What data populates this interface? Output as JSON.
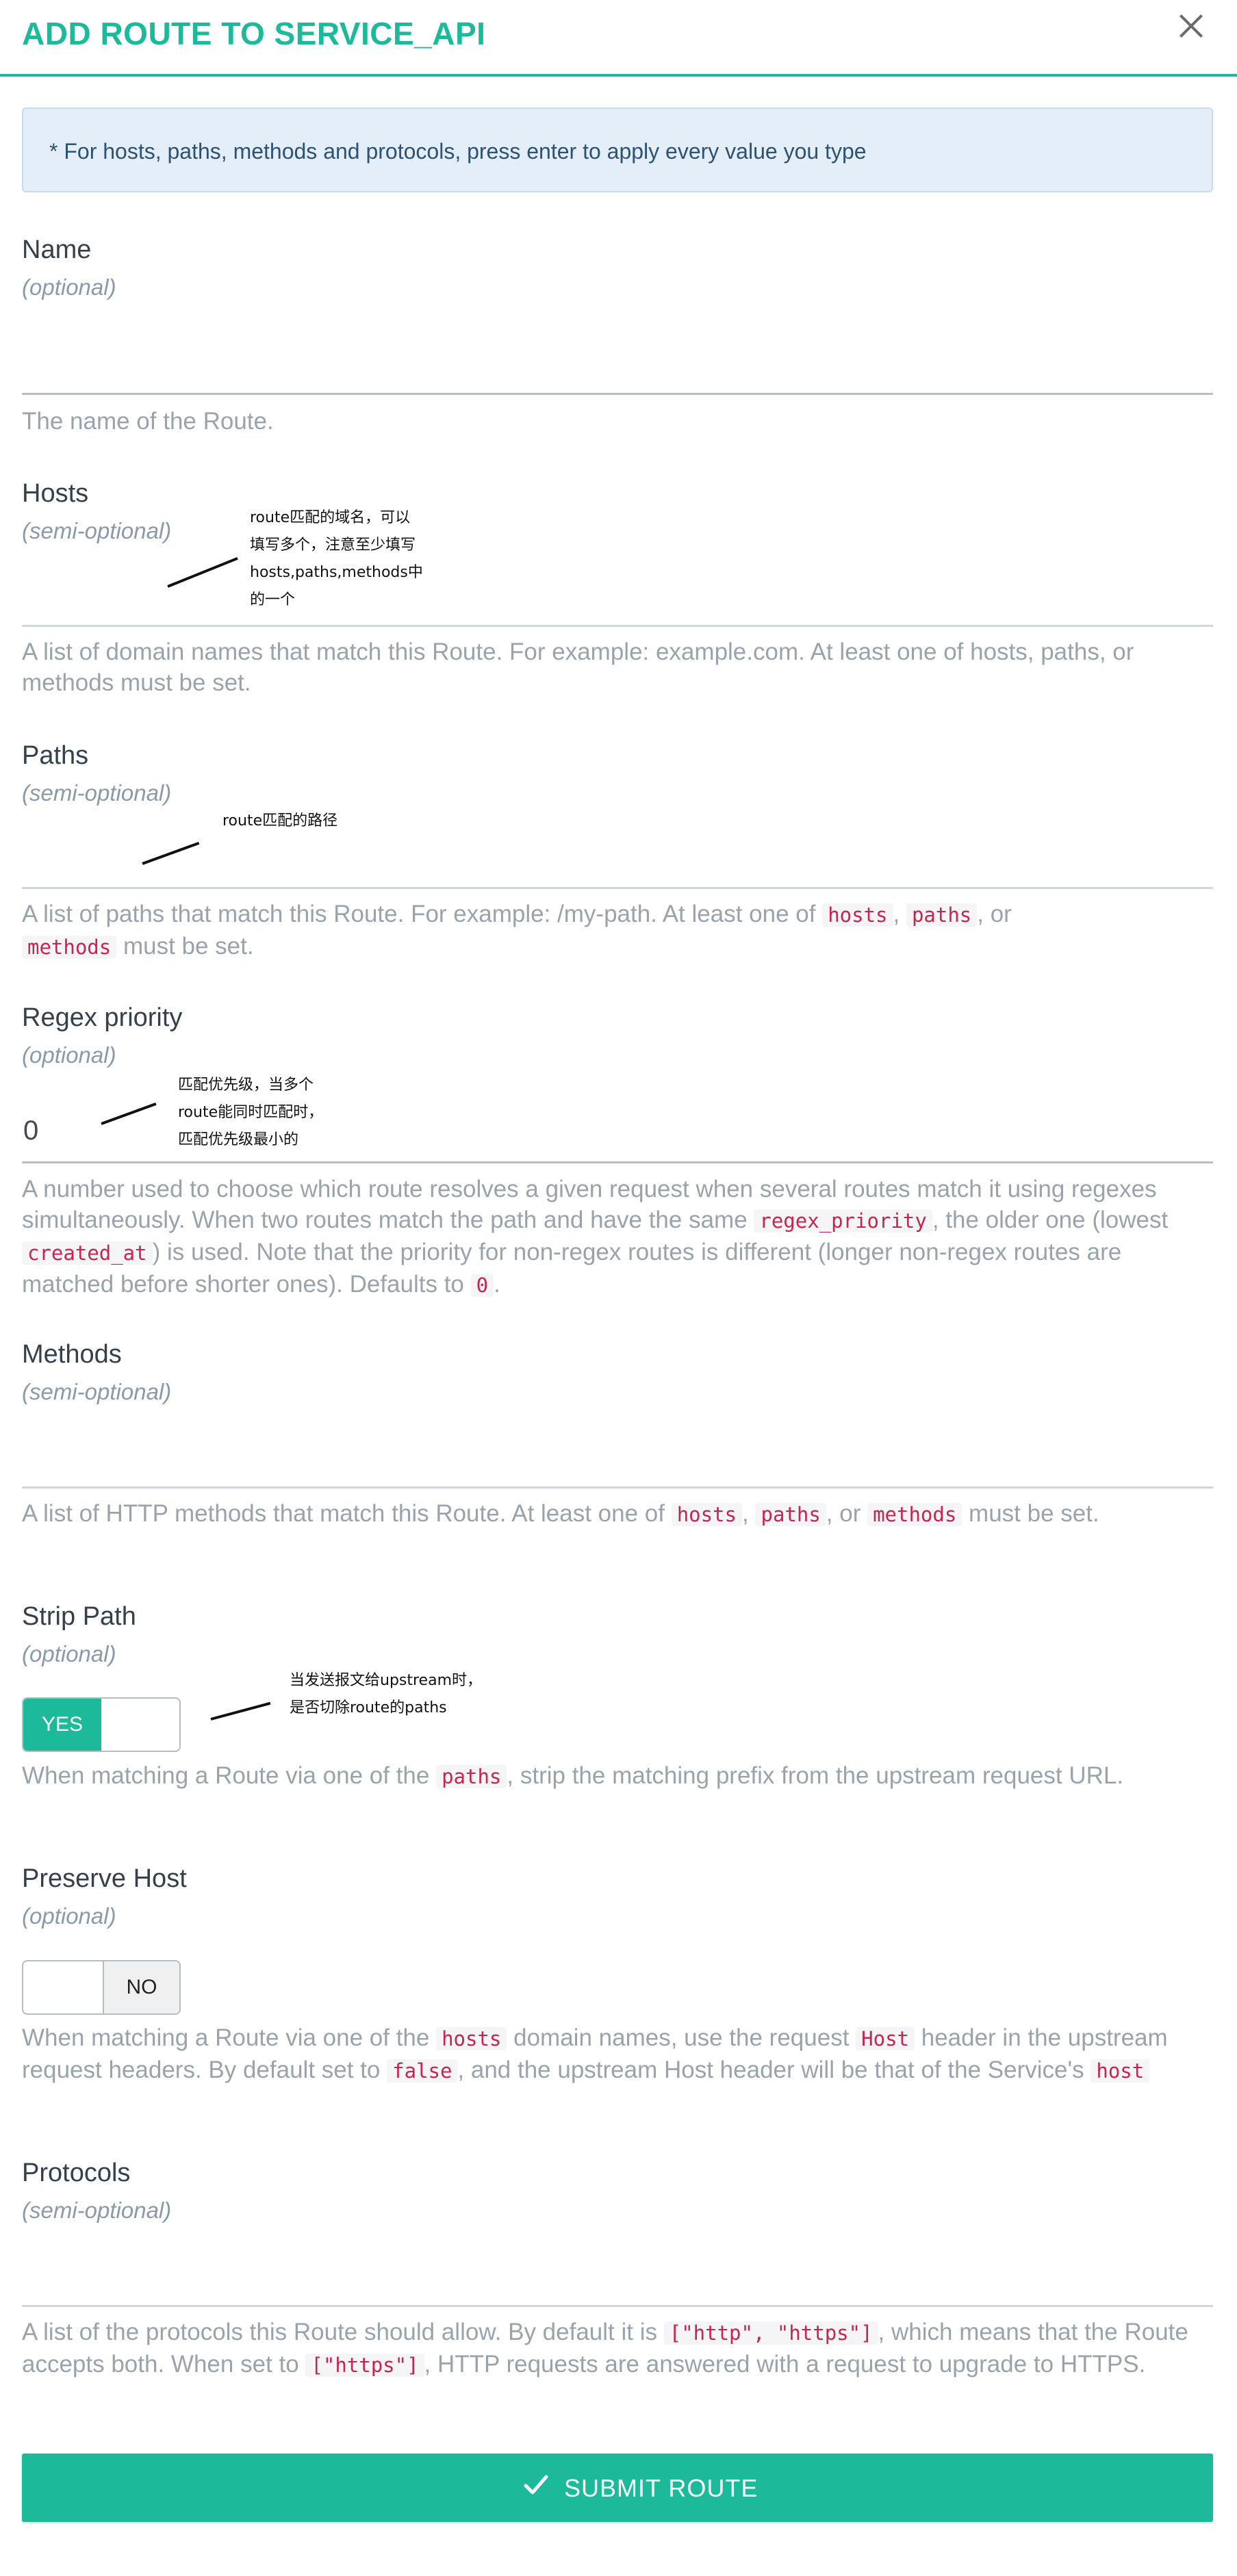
{
  "header": {
    "title": "ADD ROUTE TO SERVICE_API"
  },
  "notice": "* For hosts, paths, methods and protocols, press enter to apply every value you type",
  "fields": {
    "name": {
      "label": "Name",
      "qualifier": "(optional)",
      "value": "",
      "help": "The name of the Route."
    },
    "hosts": {
      "label": "Hosts",
      "qualifier": "(semi-optional)",
      "value": "",
      "help": "A list of domain names that match this Route. For example: example.com. At least one of hosts, paths, or methods must be set."
    },
    "paths": {
      "label": "Paths",
      "qualifier": "(semi-optional)",
      "value": "",
      "help_a": "A list of paths that match this Route. For example: /my-path. At least one of ",
      "help_code1": "hosts",
      "help_sep1": ", ",
      "help_code2": "paths",
      "help_sep2": ", or",
      "help_code3": "methods",
      "help_b": " must be set."
    },
    "regex_priority": {
      "label": "Regex priority",
      "qualifier": "(optional)",
      "value": "0",
      "help_a": "A number used to choose which route resolves a given request when several routes match it using regexes simultaneously. When two routes match the path and have the same ",
      "help_code1": "regex_priority",
      "help_b": ", the older one (lowest ",
      "help_code2": "created_at",
      "help_c": ") is used. Note that the priority for non-regex routes is different (longer non-regex routes are matched before shorter ones). Defaults to ",
      "help_code3": "0",
      "help_d": "."
    },
    "methods": {
      "label": "Methods",
      "qualifier": "(semi-optional)",
      "value": "",
      "help_a": "A list of HTTP methods that match this Route. At least one of ",
      "help_code1": "hosts",
      "help_sep1": ", ",
      "help_code2": "paths",
      "help_sep2": ", or ",
      "help_code3": "methods",
      "help_b": " must be set."
    },
    "strip_path": {
      "label": "Strip Path",
      "qualifier": "(optional)",
      "toggle_on": "YES",
      "value": true,
      "help_a": "When matching a Route via one of the ",
      "help_code1": "paths",
      "help_b": ", strip the matching prefix from the upstream request URL."
    },
    "preserve_host": {
      "label": "Preserve Host",
      "qualifier": "(optional)",
      "toggle_off": "NO",
      "value": false,
      "help_a": "When matching a Route via one of the ",
      "help_code1": "hosts",
      "help_b": " domain names, use the request ",
      "help_code2": "Host",
      "help_c": " header in the upstream request headers. By default set to ",
      "help_code3": "false",
      "help_d": ", and the upstream Host header will be that of the Service's ",
      "help_code4": "host"
    },
    "protocols": {
      "label": "Protocols",
      "qualifier": "(semi-optional)",
      "value": "",
      "help_a": "A list of the protocols this Route should allow. By default it is ",
      "help_code1": "[\"http\", \"https\"]",
      "help_b": ", which means that the Route accepts both. When set to ",
      "help_code2": "[\"https\"]",
      "help_c": ", HTTP requests are answered with a request to upgrade to HTTPS."
    }
  },
  "annotations": {
    "hosts": [
      "route匹配的域名，可以",
      "填写多个，注意至少填写",
      "hosts,paths,methods中",
      "的一个"
    ],
    "paths": [
      "route匹配的路径"
    ],
    "regex_priority": [
      "匹配优先级，当多个",
      "route能同时匹配时，",
      "匹配优先级最小的"
    ],
    "strip_path": [
      "当发送报文给upstream时，",
      "是否切除route的paths"
    ]
  },
  "submit": {
    "label": "SUBMIT ROUTE",
    "icon": "check-icon"
  },
  "colors": {
    "accent": "#1cb99a",
    "notice_bg": "#e3eef8",
    "code": "#c7254e"
  }
}
